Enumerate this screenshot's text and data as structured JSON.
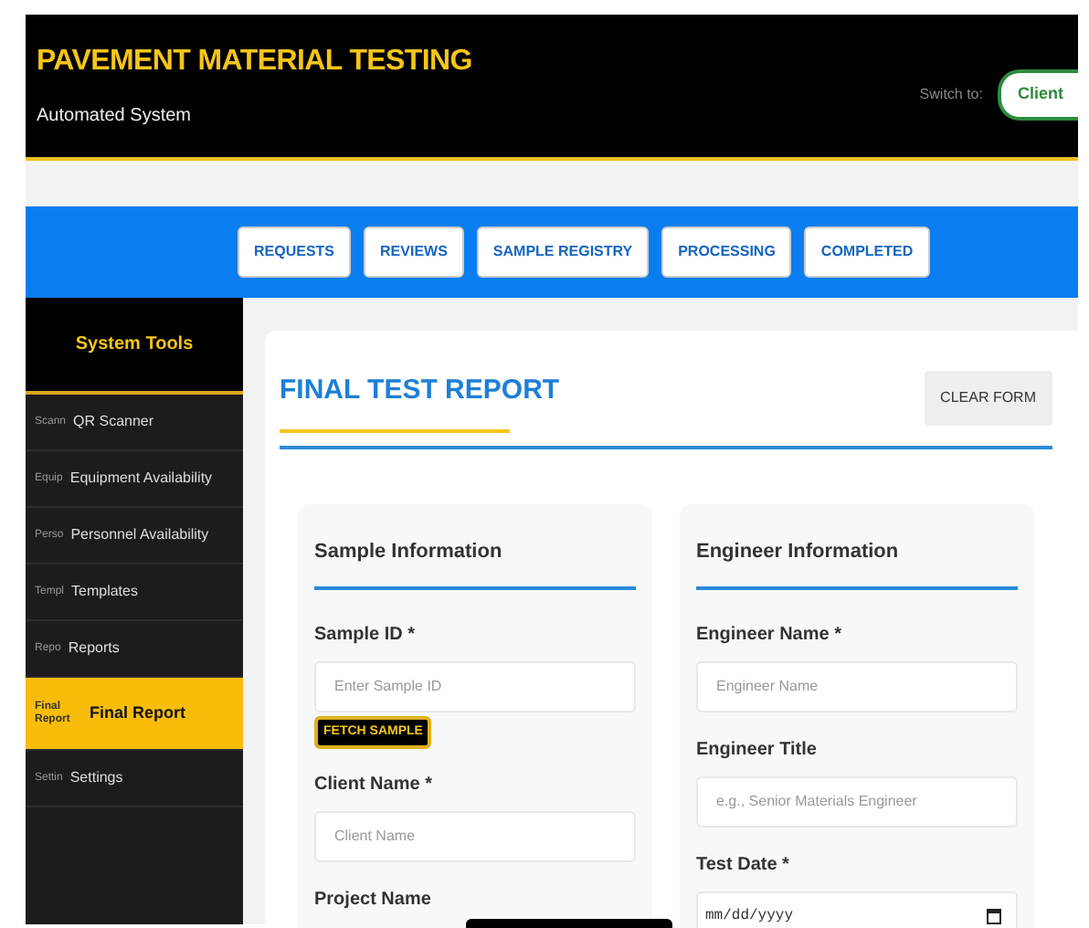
{
  "header": {
    "title": "PAVEMENT MATERIAL TESTING",
    "subtitle": "Automated System",
    "switch_label": "Switch to:",
    "switch_button": "Client"
  },
  "nav": [
    {
      "label": "REQUESTS"
    },
    {
      "label": "REVIEWS"
    },
    {
      "label": "SAMPLE REGISTRY"
    },
    {
      "label": "PROCESSING"
    },
    {
      "label": "COMPLETED"
    }
  ],
  "sidebar": {
    "title": "System Tools",
    "items": [
      {
        "icon_text": "Scann",
        "label": "QR Scanner",
        "selected": false
      },
      {
        "icon_text": "Equip",
        "label": "Equipment Availability",
        "selected": false
      },
      {
        "icon_text": "Perso",
        "label": "Personnel Availability",
        "selected": false
      },
      {
        "icon_text": "Templ",
        "label": "Templates",
        "selected": false
      },
      {
        "icon_text": "Repo",
        "label": "Reports",
        "selected": false
      },
      {
        "icon_text": "Final Report",
        "label": "Final Report",
        "selected": true
      },
      {
        "icon_text": "Settin",
        "label": "Settings",
        "selected": false
      }
    ]
  },
  "report": {
    "title": "FINAL TEST REPORT",
    "clear_button": "CLEAR FORM",
    "sections": [
      {
        "title": "Sample Information",
        "fields": [
          {
            "kind": "input",
            "label": "Sample ID *",
            "placeholder": "Enter Sample ID"
          },
          {
            "kind": "button",
            "label": "FETCH SAMPLE"
          },
          {
            "kind": "input",
            "label": "Client Name *",
            "placeholder": "Client Name"
          },
          {
            "kind": "input",
            "label": "Project Name"
          }
        ]
      },
      {
        "title": "Engineer Information",
        "fields": [
          {
            "kind": "input",
            "label": "Engineer Name *",
            "placeholder": "Engineer Name"
          },
          {
            "kind": "input",
            "label": "Engineer Title",
            "placeholder": "e.g., Senior Materials Engineer"
          },
          {
            "kind": "date",
            "label": "Test Date *",
            "value": "mm/dd/yyyy"
          }
        ]
      }
    ]
  }
}
